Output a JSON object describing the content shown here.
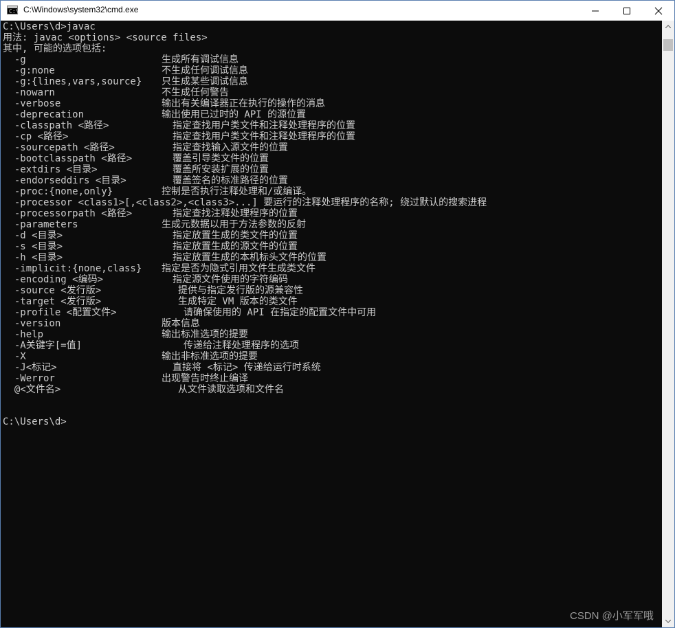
{
  "window": {
    "title": "C:\\Windows\\system32\\cmd.exe",
    "icon": "console-app-icon",
    "icon_prompt": "C:\\",
    "controls": {
      "minimize": "minimize-icon",
      "maximize": "maximize-icon",
      "close": "close-icon"
    }
  },
  "console": {
    "lines": [
      "C:\\Users\\d>javac",
      "用法: javac <options> <source files>",
      "其中, 可能的选项包括:"
    ],
    "options": [
      {
        "opt": "  -g",
        "desc": "生成所有调试信息",
        "col": 234
      },
      {
        "opt": "  -g:none",
        "desc": "不生成任何调试信息",
        "col": 234
      },
      {
        "opt": "  -g:{lines,vars,source}",
        "desc": "只生成某些调试信息",
        "col": 234
      },
      {
        "opt": "  -nowarn",
        "desc": "不生成任何警告",
        "col": 234
      },
      {
        "opt": "  -verbose",
        "desc": "输出有关编译器正在执行的操作的消息",
        "col": 234
      },
      {
        "opt": "  -deprecation",
        "desc": "输出使用已过时的 API 的源位置",
        "col": 234
      },
      {
        "opt": "  -classpath <路径>",
        "desc": "指定查找用户类文件和注释处理程序的位置",
        "col": 250
      },
      {
        "opt": "  -cp <路径>",
        "desc": "指定查找用户类文件和注释处理程序的位置",
        "col": 250
      },
      {
        "opt": "  -sourcepath <路径>",
        "desc": "指定查找输入源文件的位置",
        "col": 250
      },
      {
        "opt": "  -bootclasspath <路径>",
        "desc": "覆盖引导类文件的位置",
        "col": 250
      },
      {
        "opt": "  -extdirs <目录>",
        "desc": "覆盖所安装扩展的位置",
        "col": 250
      },
      {
        "opt": "  -endorseddirs <目录>",
        "desc": "覆盖签名的标准路径的位置",
        "col": 250
      },
      {
        "opt": "  -proc:{none,only}",
        "desc": "控制是否执行注释处理和/或编译。",
        "col": 234
      },
      {
        "opt": "  -processor <class1>[,<class2>,<class3>...] 要运行的注释处理程序的名称; 绕过默认的搜索进程",
        "desc": "",
        "col": 234
      },
      {
        "opt": "  -processorpath <路径>",
        "desc": "指定查找注释处理程序的位置",
        "col": 250
      },
      {
        "opt": "  -parameters",
        "desc": "生成元数据以用于方法参数的反射",
        "col": 234
      },
      {
        "opt": "  -d <目录>",
        "desc": "指定放置生成的类文件的位置",
        "col": 250
      },
      {
        "opt": "  -s <目录>",
        "desc": "指定放置生成的源文件的位置",
        "col": 250
      },
      {
        "opt": "  -h <目录>",
        "desc": "指定放置生成的本机标头文件的位置",
        "col": 250
      },
      {
        "opt": "  -implicit:{none,class}",
        "desc": "指定是否为隐式引用文件生成类文件",
        "col": 234
      },
      {
        "opt": "  -encoding <编码>",
        "desc": "指定源文件使用的字符编码",
        "col": 250
      },
      {
        "opt": "  -source <发行版>",
        "desc": "提供与指定发行版的源兼容性",
        "col": 258
      },
      {
        "opt": "  -target <发行版>",
        "desc": "生成特定 VM 版本的类文件",
        "col": 258
      },
      {
        "opt": "  -profile <配置文件>",
        "desc": "请确保使用的 API 在指定的配置文件中可用",
        "col": 266
      },
      {
        "opt": "  -version",
        "desc": "版本信息",
        "col": 234
      },
      {
        "opt": "  -help",
        "desc": "输出标准选项的提要",
        "col": 234
      },
      {
        "opt": "  -A关键字[=值]",
        "desc": "传递给注释处理程序的选项",
        "col": 266
      },
      {
        "opt": "  -X",
        "desc": "输出非标准选项的提要",
        "col": 234
      },
      {
        "opt": "  -J<标记>",
        "desc": "直接将 <标记> 传递给运行时系统",
        "col": 250
      },
      {
        "opt": "  -Werror",
        "desc": "出现警告时终止编译",
        "col": 234
      },
      {
        "opt": "  @<文件名>",
        "desc": "从文件读取选项和文件名",
        "col": 258
      }
    ],
    "prompt": "C:\\Users\\d>"
  },
  "watermark": "CSDN @小军军哦",
  "colors": {
    "console_bg": "#0c0c0c",
    "console_text": "#cccccc",
    "titlebar_bg": "#ffffff"
  }
}
